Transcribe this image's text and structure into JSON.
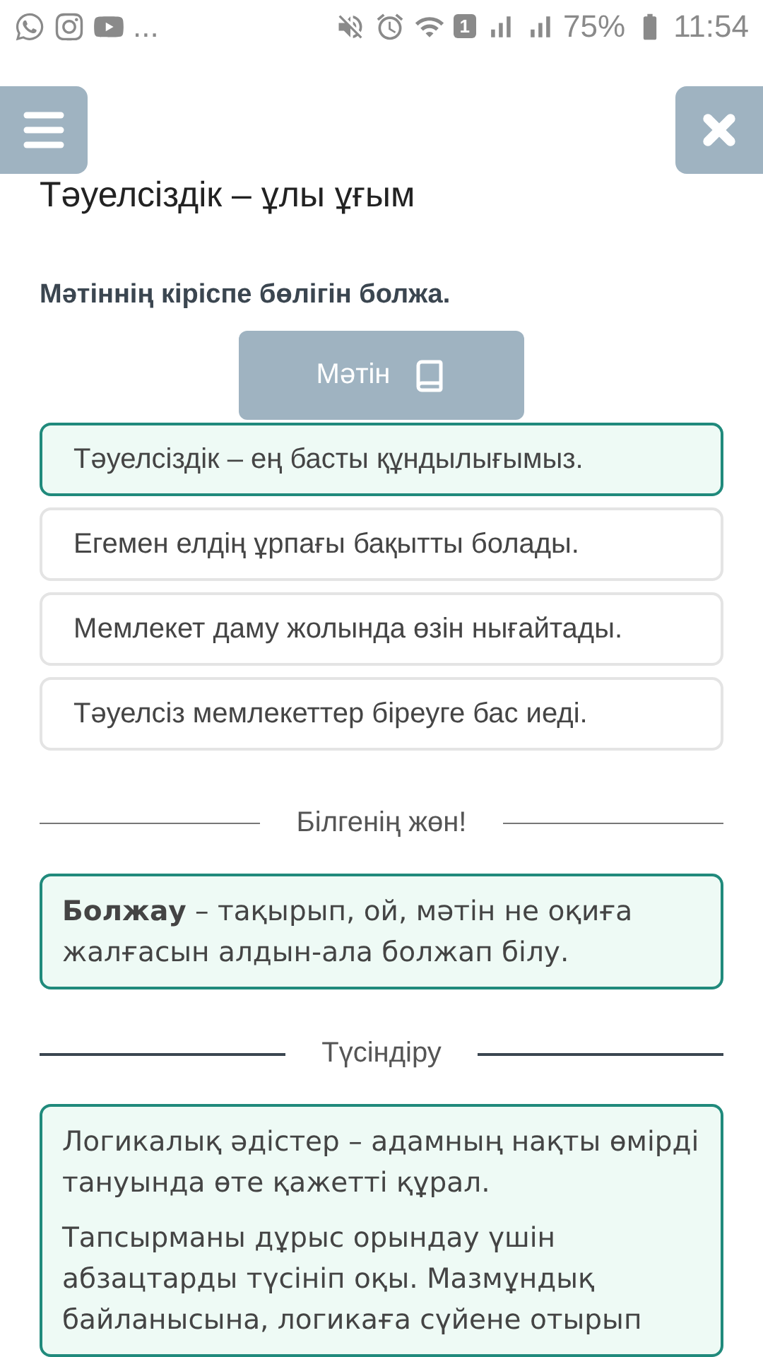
{
  "status_bar": {
    "notification_more": "...",
    "sim_slot": "1",
    "battery": "75%",
    "time": "11:54"
  },
  "title": "Тәуелсіздік – ұлы ұғым",
  "question": "Мәтіннің кіріспе бөлігін болжа.",
  "text_button": "Мәтін",
  "options": [
    {
      "label": "Тәуелсіздік – ең басты құндылығымыз.",
      "selected": true
    },
    {
      "label": "Егемен елдің ұрпағы бақытты болады.",
      "selected": false
    },
    {
      "label": "Мемлекет даму жолында өзін нығайтады.",
      "selected": false
    },
    {
      "label": "Тәуелсіз мемлекеттер біреуге бас иеді.",
      "selected": false
    }
  ],
  "info": {
    "heading": "Білгенің жөн!",
    "text": "**Болжау** – тақырып, ой, мәтін не оқиға жалғасын алдын-ала болжап білу."
  },
  "explanation": {
    "heading": "Түсіндіру",
    "paragraphs": [
      "Логикалық әдістер – адамның нақты өмірді тануында өте қажетті құрал.",
      "Тапсырманы дұрыс орындау үшін абзацтарды түсініп оқы. Мазмұндық байланысына, логикаға сүйене отырып"
    ]
  }
}
